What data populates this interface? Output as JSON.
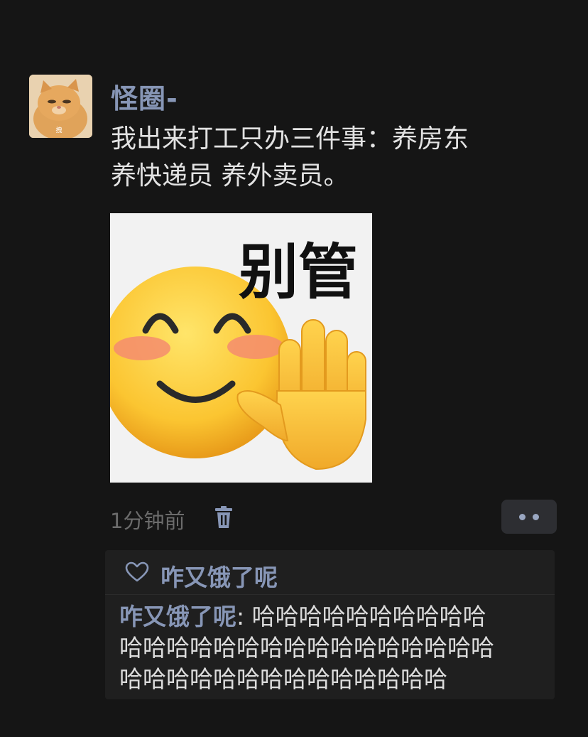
{
  "post": {
    "author": "怪圈-",
    "text_line1": "我出来打工只办三件事：养房东",
    "text_line2": "养快递员 养外卖员。",
    "image_caption": "别管",
    "avatar_label": "拽",
    "time": "1分钟前"
  },
  "likes": {
    "names": "咋又饿了呢"
  },
  "comment": {
    "author": "咋又饿了呢",
    "separator": ": ",
    "line1": "哈哈哈哈哈哈哈哈哈哈",
    "line2": "哈哈哈哈哈哈哈哈哈哈哈哈哈哈哈哈",
    "line3": "哈哈哈哈哈哈哈哈哈哈哈哈哈哈"
  },
  "icons": {
    "delete": "trash-icon",
    "more": "more-dots-icon",
    "like": "heart-outline-icon"
  },
  "colors": {
    "background": "#151515",
    "name_link": "#8796b6",
    "text": "#e2e2e2",
    "muted": "#6c6c6c",
    "comment_bg": "#1f1f1f"
  }
}
